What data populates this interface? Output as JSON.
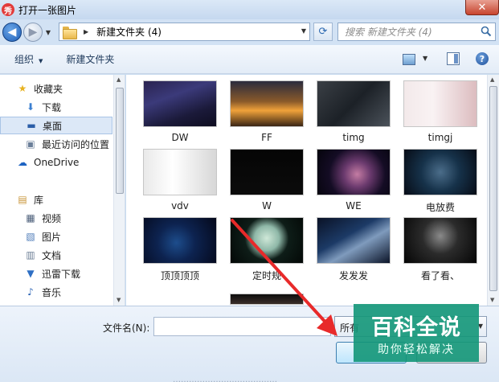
{
  "window": {
    "title": "打开一张图片",
    "app_icon_glyph": "秀",
    "close_glyph": "✕"
  },
  "navigation": {
    "back_glyph": "◀",
    "forward_glyph": "▶",
    "current_folder": "新建文件夹 (4)",
    "search_placeholder": "搜索 新建文件夹 (4)"
  },
  "toolbar": {
    "organize_label": "组织",
    "new_folder_label": "新建文件夹",
    "help_glyph": "?"
  },
  "sidebar": {
    "items": [
      {
        "label": "收藏夹",
        "icon": "star-icon",
        "glyph": "★",
        "color": "#e8b21f"
      },
      {
        "label": "下载",
        "icon": "download-folder-icon",
        "glyph": "⬇",
        "color": "#3b7fd1"
      },
      {
        "label": "桌面",
        "icon": "desktop-icon",
        "glyph": "▬",
        "color": "#2b5ea8"
      },
      {
        "label": "最近访问的位置",
        "icon": "recent-places-icon",
        "glyph": "▣",
        "color": "#6b7f99"
      },
      {
        "label": "OneDrive",
        "icon": "cloud-icon",
        "glyph": "☁",
        "color": "#1d63c2"
      },
      {
        "label": "库",
        "icon": "libraries-icon",
        "glyph": "▤",
        "color": "#c9963a"
      },
      {
        "label": "视频",
        "icon": "video-icon",
        "glyph": "▦",
        "color": "#4c5f7a"
      },
      {
        "label": "图片",
        "icon": "pictures-icon",
        "glyph": "▧",
        "color": "#4e7bb8"
      },
      {
        "label": "文档",
        "icon": "documents-icon",
        "glyph": "▥",
        "color": "#6d7f96"
      },
      {
        "label": "迅雷下载",
        "icon": "thunder-download-icon",
        "glyph": "▼",
        "color": "#2e6fc4"
      },
      {
        "label": "音乐",
        "icon": "music-icon",
        "glyph": "♪",
        "color": "#2a62b4"
      }
    ]
  },
  "files": [
    {
      "name": "DW",
      "bg": "linear-gradient(160deg, #2a2350 0%, #3b3a7a 35%, #1b1a3a 70%, #0e0d20 100%)"
    },
    {
      "name": "FF",
      "bg": "linear-gradient(180deg, #2b2b3d 0%, #8a5a2a 45%, #f0a23a 65%, #3a2414 100%)"
    },
    {
      "name": "timg",
      "bg": "linear-gradient(135deg, #3a3f45 0%, #1c2127 50%, #4b525a 100%)"
    },
    {
      "name": "timgj",
      "bg": "linear-gradient(90deg, #f3e9ea 0%, #f9f2f3 40%, #dcbcbf 100%)"
    },
    {
      "name": "vdv",
      "bg": "linear-gradient(90deg, #e9e9e9 0%, #ffffff 40%, #d7d7d7 100%)"
    },
    {
      "name": "W",
      "bg": "linear-gradient(180deg, #050505 0%, #0b0b0b 100%)"
    },
    {
      "name": "WE",
      "bg": "radial-gradient(circle at 55% 55%, #c47ca3 0%, #6b3a6e 28%, #140c24 60%, #05040c 100%)"
    },
    {
      "name": "电放费",
      "bg": "radial-gradient(circle at 50% 50%, #4b6d8a 0%, #16324a 45%, #070c16 100%)"
    },
    {
      "name": "顶顶顶顶",
      "bg": "radial-gradient(circle at 45% 55%, #1d4d8c 0%, #0d2350 40%, #04081a 100%)"
    },
    {
      "name": "定时规",
      "bg": "radial-gradient(circle at 50% 45%, #cfe8d8 0%, #8fb8a8 28%, #0e1d18 50%, #030806 100%)"
    },
    {
      "name": "发发发",
      "bg": "linear-gradient(150deg, #0a1226 0%, #1c3a66 40%, #7f9bbd 60%, #0b1428 100%)"
    },
    {
      "name": "看了看、",
      "bg": "radial-gradient(circle at 50% 40%, #8a8a8a 0%, #2b2b2b 40%, #050505 100%)"
    }
  ],
  "partial_tile": {
    "bg": "linear-gradient(180deg, #0d0d0d 0%, #3b2f2a 100%)"
  },
  "footer": {
    "filename_label": "文件名(N):",
    "filename_value": "",
    "filter_visible_text": "所有",
    "below_text": "…………………………………"
  },
  "watermark": {
    "title": "百科全说",
    "subtitle": "助你轻松解决"
  }
}
